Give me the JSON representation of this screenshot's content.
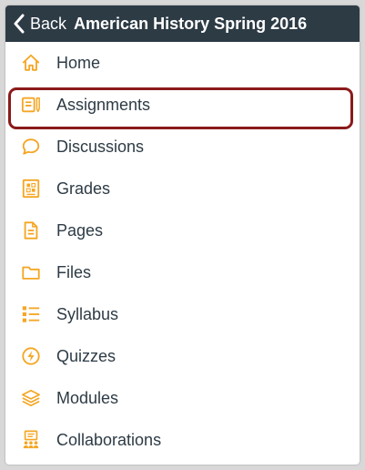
{
  "navbar": {
    "back_label": "Back",
    "title": "American History Spring 2016"
  },
  "colors": {
    "navbar_bg": "#2d3b45",
    "icon_accent": "#f5a623",
    "highlight_border": "#8b1a1a"
  },
  "menu": {
    "items": [
      {
        "label": "Home",
        "icon": "home-icon"
      },
      {
        "label": "Assignments",
        "icon": "assignments-icon",
        "highlighted": true
      },
      {
        "label": "Discussions",
        "icon": "discussions-icon"
      },
      {
        "label": "Grades",
        "icon": "grades-icon"
      },
      {
        "label": "Pages",
        "icon": "pages-icon"
      },
      {
        "label": "Files",
        "icon": "files-icon"
      },
      {
        "label": "Syllabus",
        "icon": "syllabus-icon"
      },
      {
        "label": "Quizzes",
        "icon": "quizzes-icon"
      },
      {
        "label": "Modules",
        "icon": "modules-icon"
      },
      {
        "label": "Collaborations",
        "icon": "collaborations-icon"
      }
    ]
  }
}
